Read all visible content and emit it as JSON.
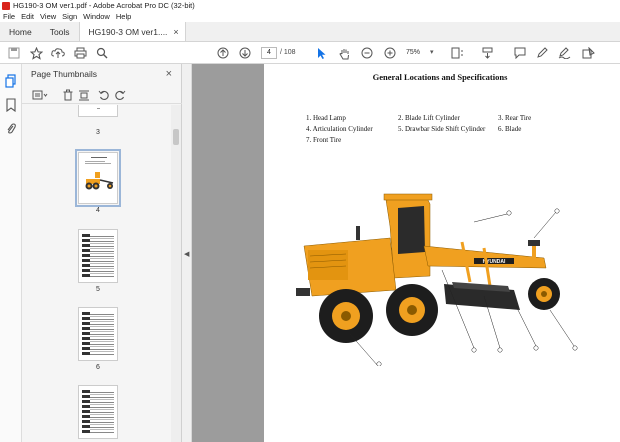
{
  "window": {
    "title": "HG190-3 OM ver1.pdf - Adobe Acrobat Pro DC (32-bit)"
  },
  "menu": [
    "File",
    "Edit",
    "View",
    "Sign",
    "Window",
    "Help"
  ],
  "tabs": {
    "home": "Home",
    "tools": "Tools",
    "document": "HG190-3 OM ver1....",
    "close": "×"
  },
  "toolbar": {
    "page_current": "4",
    "page_total": "/ 108",
    "zoom": "75%"
  },
  "panel": {
    "title": "Page Thumbnails",
    "close": "×",
    "thumbnails": [
      {
        "label": "3"
      },
      {
        "label": "4"
      },
      {
        "label": "5"
      },
      {
        "label": "6"
      },
      {
        "label": ""
      }
    ]
  },
  "page": {
    "title": "General Locations and Specifications",
    "legend": [
      "1. Head Lamp",
      "2. Blade Lift Cylinder",
      "3. Rear Tire",
      "4. Articulation Cylinder",
      "5. Drawbar Side Shift Cylinder",
      "6. Blade",
      "7. Front Tire"
    ],
    "brand": "HYUNDAI"
  },
  "colors": {
    "acrobat_red": "#d9241c",
    "machine_yellow": "#f0a020",
    "select_blue": "#9bb6d8"
  }
}
